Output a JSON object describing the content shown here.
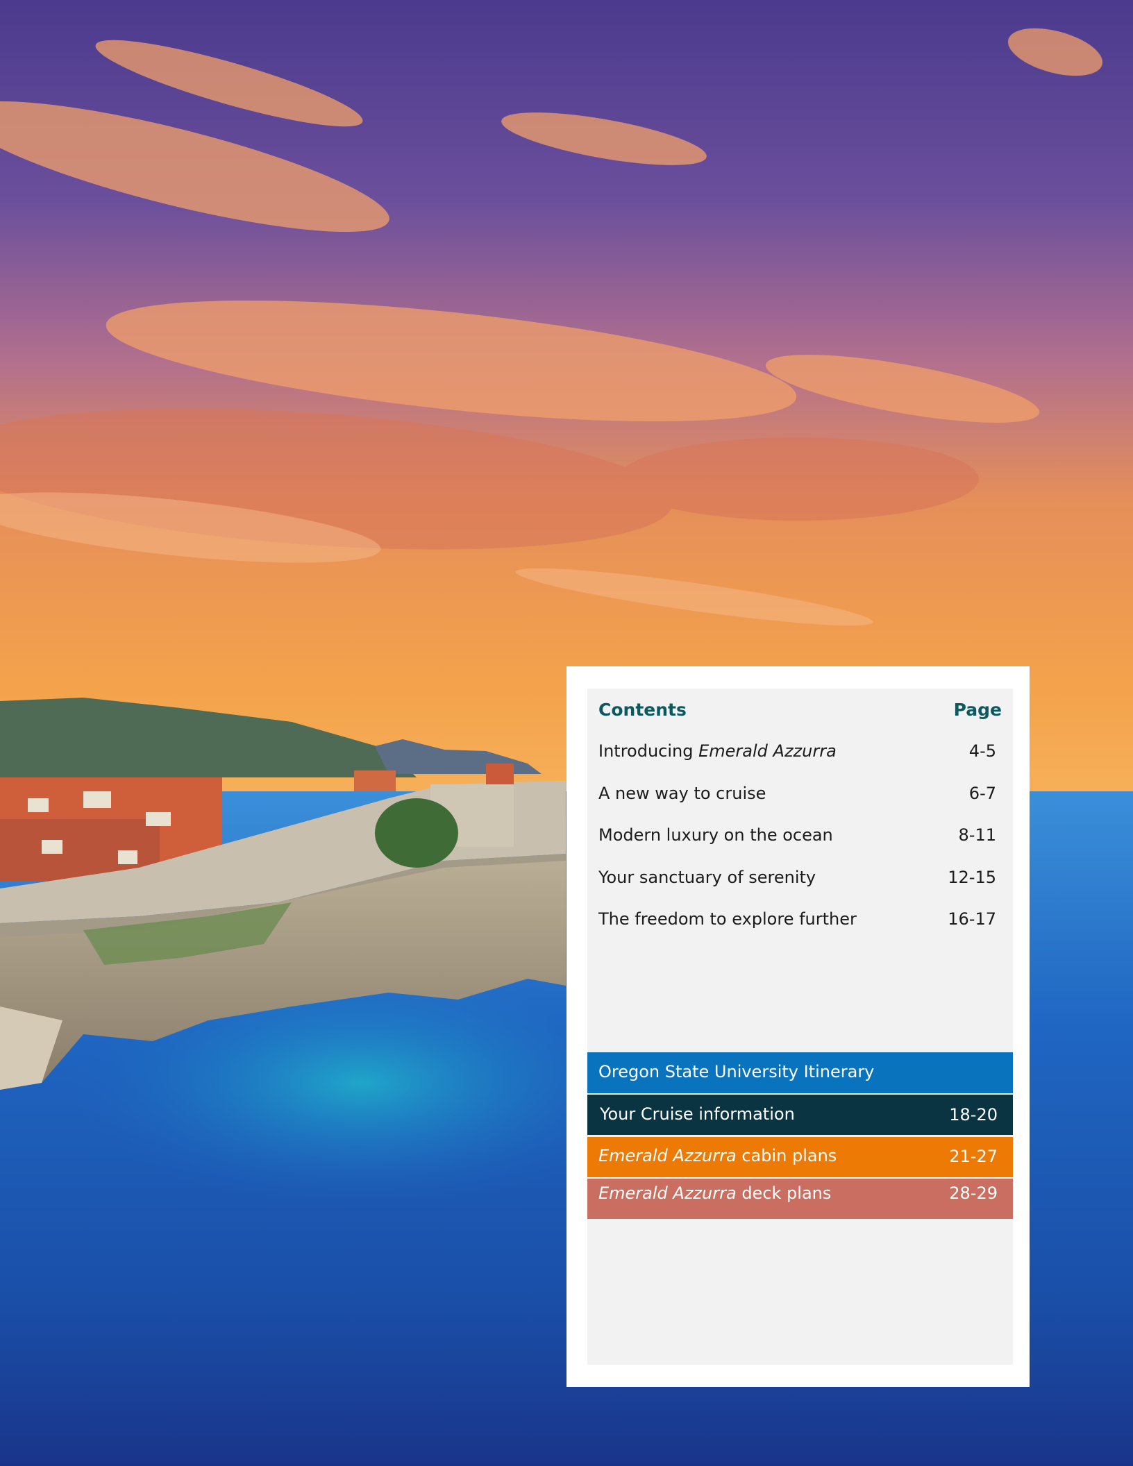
{
  "toc": {
    "header_left": "Contents",
    "header_right": "Page",
    "items": [
      {
        "prefix": "Introducing ",
        "italic": "Emerald Azzurra",
        "suffix": "",
        "pages": "4-5"
      },
      {
        "prefix": "A new way to cruise",
        "italic": "",
        "suffix": "",
        "pages": "6-7"
      },
      {
        "prefix": "Modern luxury on the ocean",
        "italic": "",
        "suffix": "",
        "pages": "8-11"
      },
      {
        "prefix": "Your sanctuary of serenity",
        "italic": "",
        "suffix": "",
        "pages": "12-15"
      },
      {
        "prefix": "The freedom to explore further",
        "italic": "",
        "suffix": "",
        "pages": "16-17"
      }
    ]
  },
  "bands": {
    "itinerary": {
      "label": "Oregon State University Itinerary",
      "color": "#0a73bd"
    },
    "cruise_info": {
      "label": "Your Cruise information",
      "pages": "18-20",
      "color": "#0b3443"
    },
    "cabin_plans": {
      "italic": "Emerald Azzurra",
      "suffix": " cabin plans",
      "pages": "21-27",
      "color": "#ee7a06"
    },
    "deck_plans": {
      "italic": "Emerald Azzurra",
      "suffix": " deck plans",
      "pages": "28-29",
      "color": "#c96e60"
    }
  },
  "colors": {
    "heading_teal": "#0c5a5f",
    "panel_bg": "#f2f2f2",
    "sky_top": "#4a3b8e",
    "sunset_orange": "#f39a45",
    "sea_blue": "#1f5fb8"
  }
}
